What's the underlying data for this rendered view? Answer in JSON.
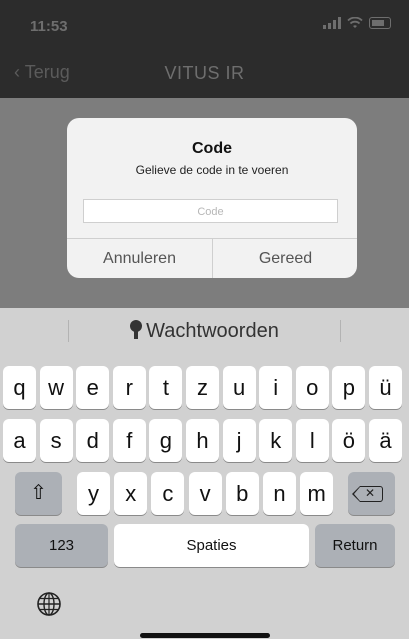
{
  "status": {
    "time": "11:53"
  },
  "nav": {
    "back_label": "Terug",
    "title": "VITUS IR"
  },
  "alert": {
    "title": "Code",
    "message": "Gelieve de code in te voeren",
    "input_placeholder": "Code",
    "cancel_label": "Annuleren",
    "done_label": "Gereed"
  },
  "keyboard": {
    "suggestion": "Wachtwoorden",
    "row1": [
      "q",
      "w",
      "e",
      "r",
      "t",
      "z",
      "u",
      "i",
      "o",
      "p",
      "ü"
    ],
    "row2": [
      "a",
      "s",
      "d",
      "f",
      "g",
      "h",
      "j",
      "k",
      "l",
      "ö",
      "ä"
    ],
    "row3": [
      "y",
      "x",
      "c",
      "v",
      "b",
      "n",
      "m"
    ],
    "numbers_label": "123",
    "space_label": "Spaties",
    "return_label": "Return",
    "shift_icon": "shift-icon",
    "backspace_icon": "backspace-icon",
    "globe_icon": "globe-icon",
    "key_color": "#ffffff",
    "special_key_color": "#acb0b6",
    "background_color": "#d1d1d1"
  }
}
